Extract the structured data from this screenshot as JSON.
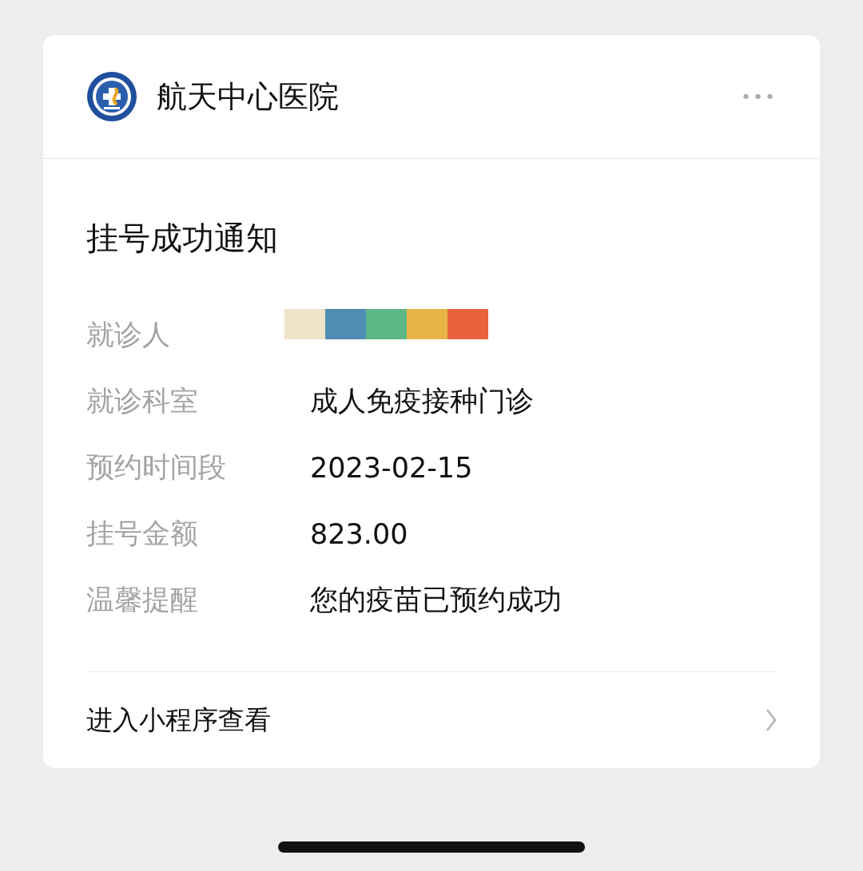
{
  "header": {
    "account_name": "航天中心医院",
    "more_icon": "•••"
  },
  "notification": {
    "title": "挂号成功通知",
    "fields": [
      {
        "label": "就诊人",
        "kind": "redacted"
      },
      {
        "label": "就诊科室",
        "kind": "text",
        "value": "成人免疫接种门诊"
      },
      {
        "label": "预约时间段",
        "kind": "text",
        "value": "2023-02-15"
      },
      {
        "label": "挂号金额",
        "kind": "text",
        "value": "823.00"
      },
      {
        "label": "温馨提醒",
        "kind": "text",
        "value": "您的疫苗已预约成功"
      }
    ]
  },
  "footer": {
    "link": "进入小程序查看"
  }
}
